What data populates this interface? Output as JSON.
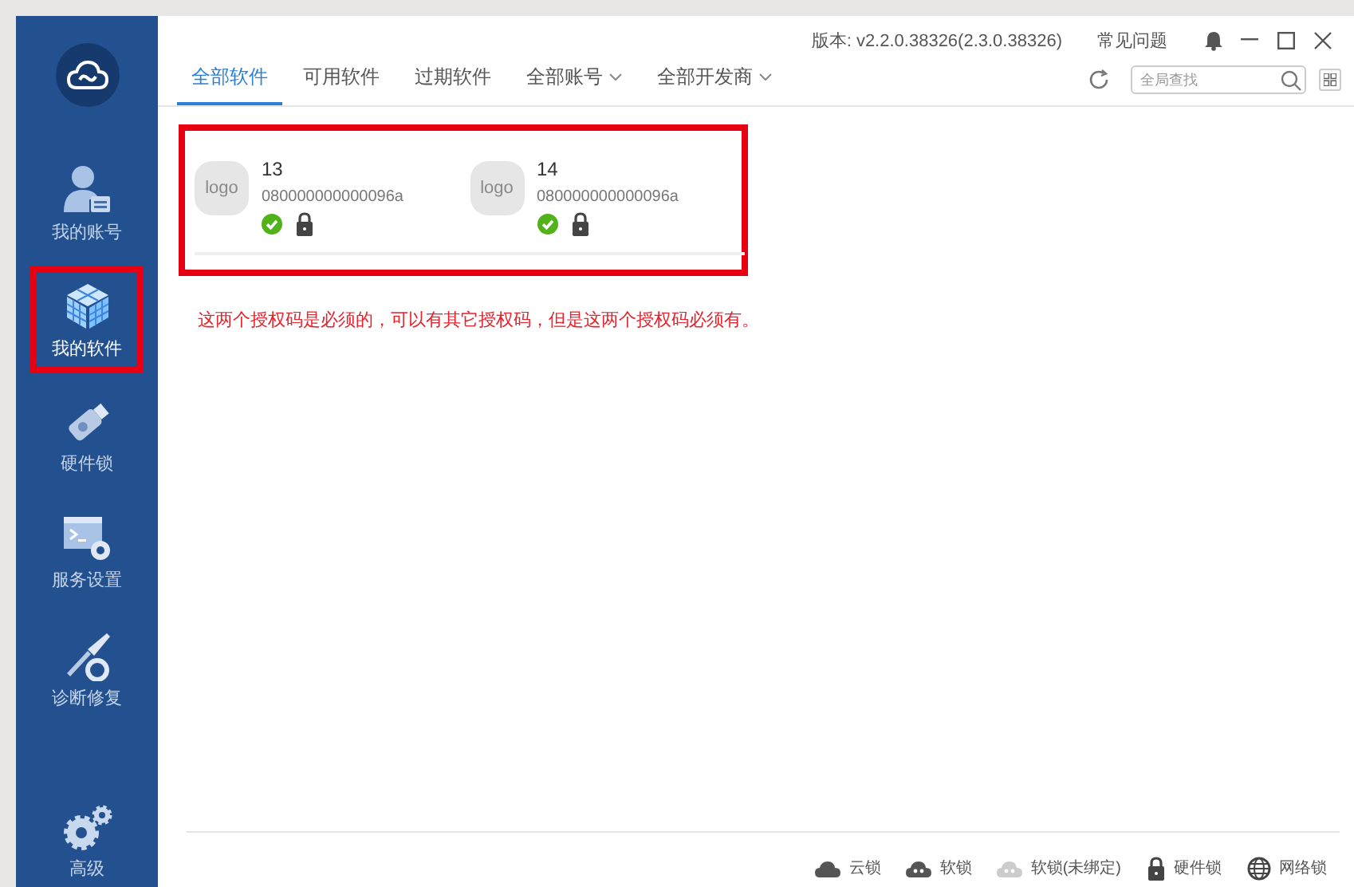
{
  "sidebar": {
    "items": [
      {
        "label": "我的账号",
        "kind": "account",
        "selected": false,
        "annotated": false
      },
      {
        "label": "我的软件",
        "kind": "cube",
        "selected": true,
        "annotated": true
      },
      {
        "label": "硬件锁",
        "kind": "usb",
        "selected": false,
        "annotated": false
      },
      {
        "label": "服务设置",
        "kind": "service",
        "selected": false,
        "annotated": false
      },
      {
        "label": "诊断修复",
        "kind": "repair",
        "selected": false,
        "annotated": false
      }
    ],
    "bottom_item": {
      "label": "高级",
      "kind": "gears",
      "selected": false
    }
  },
  "top_bar": {
    "version": "版本: v2.2.0.38326(2.3.0.38326)",
    "help": "常见问题"
  },
  "tabs": [
    {
      "label": "全部软件",
      "selected": true,
      "dropdown": false
    },
    {
      "label": "可用软件",
      "selected": false,
      "dropdown": false
    },
    {
      "label": "过期软件",
      "selected": false,
      "dropdown": false
    },
    {
      "label": "全部账号",
      "selected": false,
      "dropdown": true
    },
    {
      "label": "全部开发商",
      "selected": false,
      "dropdown": true
    }
  ],
  "search": {
    "placeholder": "全局查找"
  },
  "software": {
    "annotated": true,
    "cards": [
      {
        "logo": "logo",
        "name": "13",
        "code": "080000000000096a"
      },
      {
        "logo": "logo",
        "name": "14",
        "code": "080000000000096a"
      }
    ]
  },
  "note": "这两个授权码是必须的，可以有其它授权码，但是这两个授权码必须有。",
  "legend": [
    {
      "kind": "cloud",
      "label": "云锁"
    },
    {
      "kind": "soft",
      "label": "软锁"
    },
    {
      "kind": "soft-unbound",
      "label": "软锁(未绑定)"
    },
    {
      "kind": "hardware",
      "label": "硬件锁"
    },
    {
      "kind": "network",
      "label": "网络锁"
    }
  ]
}
